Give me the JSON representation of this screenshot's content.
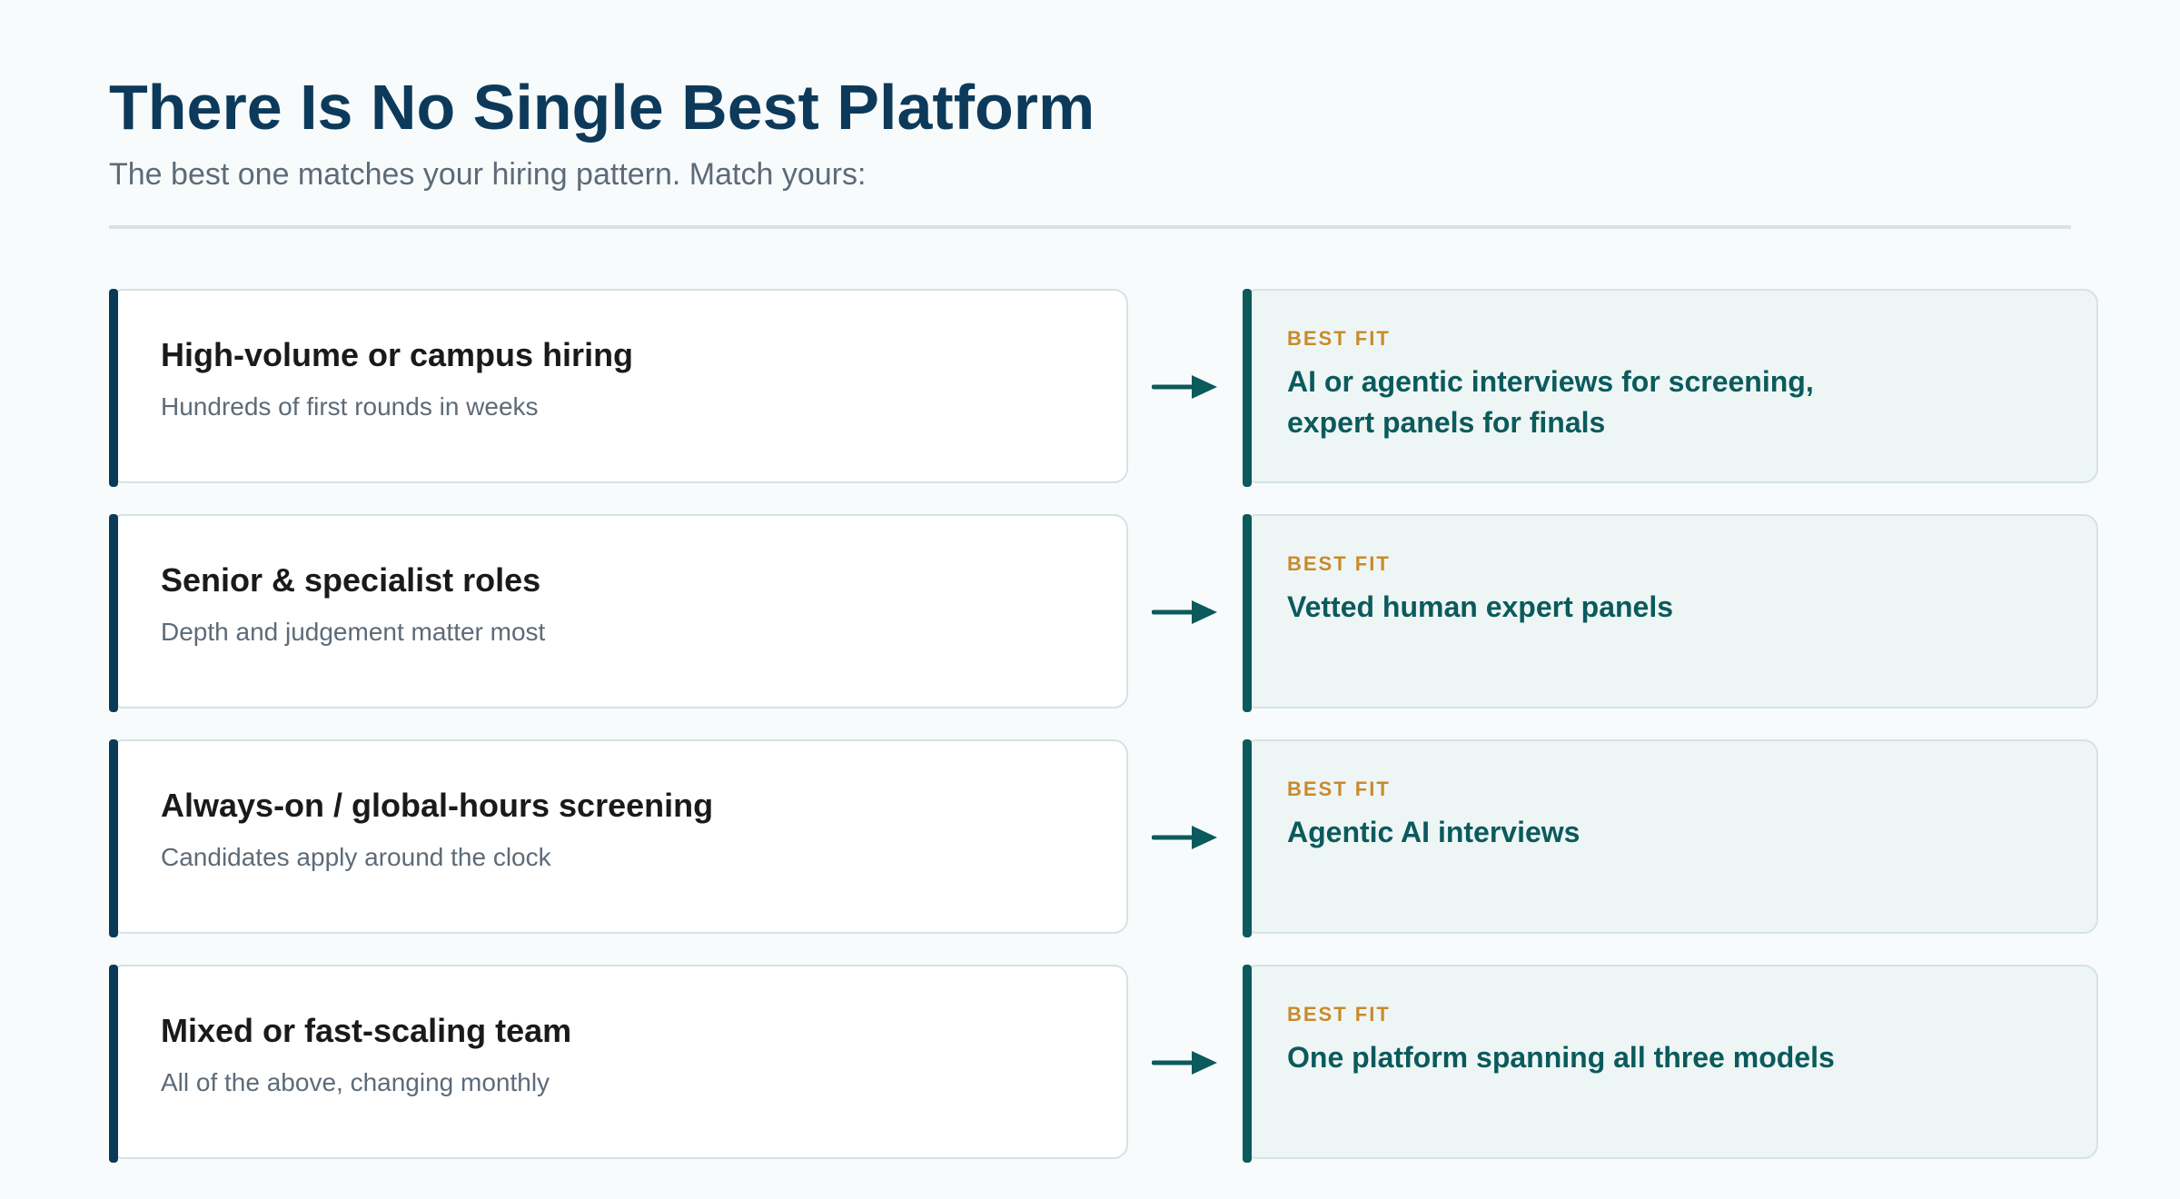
{
  "header": {
    "title": "There Is No Single Best Platform",
    "subtitle": "The best one matches your hiring pattern. Match yours:"
  },
  "rows": [
    {
      "scenario_title": "High-volume or campus hiring",
      "scenario_sub": "Hundreds of first rounds in weeks",
      "fit_label": "BEST FIT",
      "fit_text": "AI or agentic interviews for screening, expert panels for finals"
    },
    {
      "scenario_title": "Senior & specialist roles",
      "scenario_sub": "Depth and judgement matter most",
      "fit_label": "BEST FIT",
      "fit_text": "Vetted human expert panels"
    },
    {
      "scenario_title": "Always-on / global-hours screening",
      "scenario_sub": "Candidates apply around the clock",
      "fit_label": "BEST FIT",
      "fit_text": "Agentic AI interviews"
    },
    {
      "scenario_title": "Mixed or fast-scaling team",
      "scenario_sub": "All of the above, changing monthly",
      "fit_label": "BEST FIT",
      "fit_text": "One platform spanning all three models"
    }
  ],
  "icons": {
    "arrow": "arrow-right-icon"
  },
  "colors": {
    "title": "#0d3a5a",
    "scenario_accent": "#0b3a57",
    "fit_accent": "#0b5a5c",
    "fit_label": "#c98a2c",
    "fit_background": "#eef6f5"
  }
}
